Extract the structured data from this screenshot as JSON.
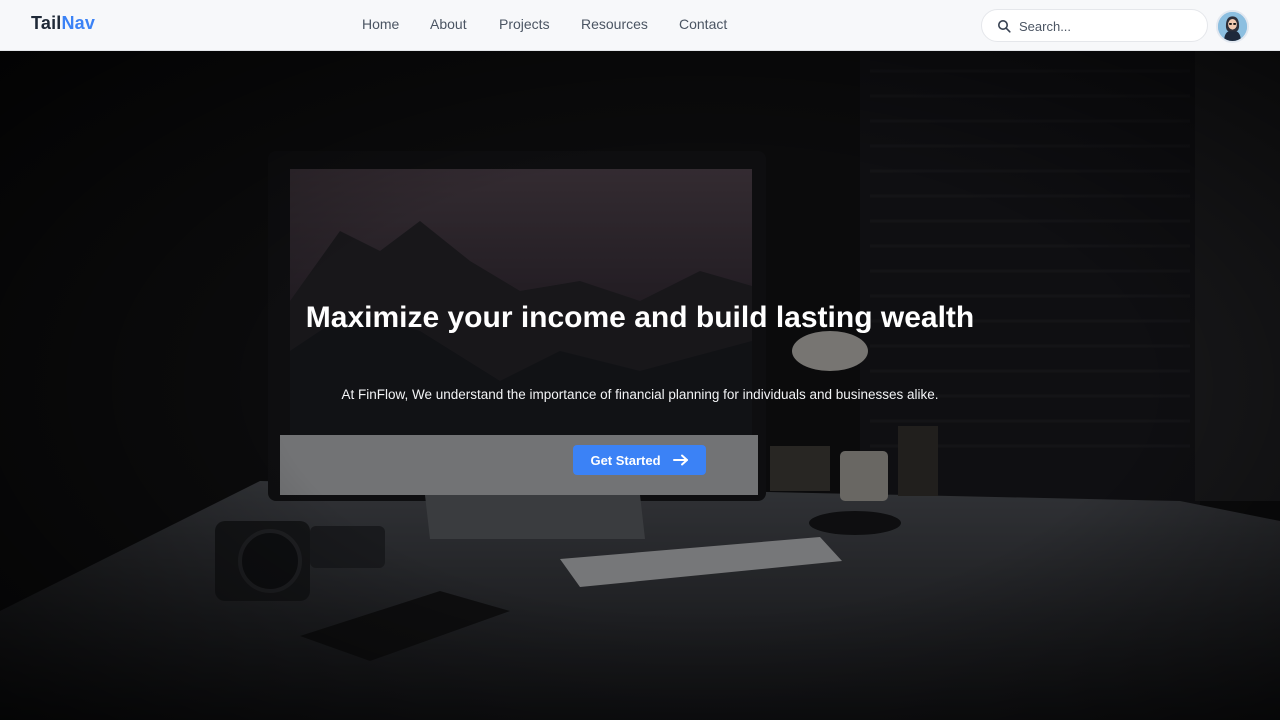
{
  "brand": {
    "part1": "Tail",
    "part2": "Nav"
  },
  "nav": {
    "items": [
      {
        "label": "Home"
      },
      {
        "label": "About"
      },
      {
        "label": "Projects"
      },
      {
        "label": "Resources"
      },
      {
        "label": "Contact"
      }
    ]
  },
  "search": {
    "placeholder": "Search..."
  },
  "user": {
    "avatar_icon": "user-avatar"
  },
  "hero": {
    "headline": "Maximize your income and build lasting wealth",
    "subtext": "At FinFlow, We understand the importance of financial planning for individuals and businesses alike.",
    "cta_label": "Get Started",
    "cta_icon": "arrow-right-icon"
  },
  "colors": {
    "accent": "#3b82f6",
    "navbar_bg": "#f7f8fa",
    "hero_overlay": "#000000"
  }
}
